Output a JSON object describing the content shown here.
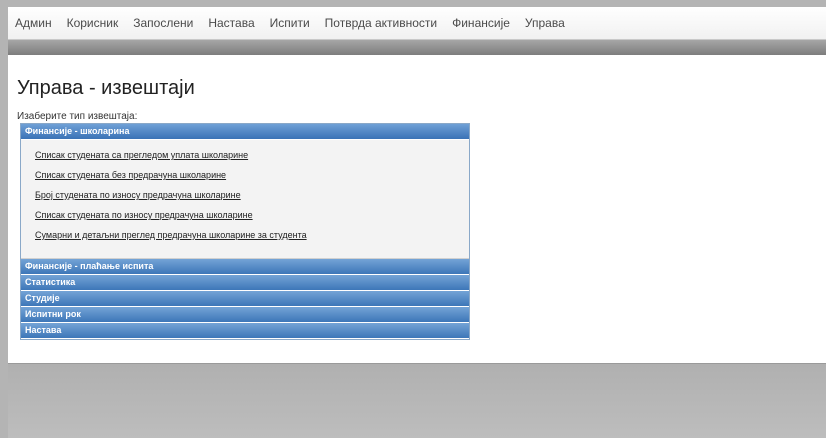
{
  "nav": {
    "items": [
      "Админ",
      "Корисник",
      "Запослени",
      "Настава",
      "Испити",
      "Потврда активности",
      "Финансије",
      "Управа"
    ]
  },
  "page": {
    "title": "Управа - извештаји",
    "choose_label": "Изаберите тип извештаја:"
  },
  "accordion": {
    "sections": [
      {
        "title": "Финансије - школарина",
        "expanded": true,
        "links": [
          "Списак студената са прегледом уплата школарине",
          "Списак студената без предрачуна школарине",
          "Број студената по износу предрачуна школарине",
          "Списак студената по износу предрачуна школарине",
          "Сумарни и детаљни преглед предрачуна школарине за студента"
        ]
      },
      {
        "title": "Финансије - плаћање испита",
        "expanded": false
      },
      {
        "title": "Статистика",
        "expanded": false
      },
      {
        "title": "Студије",
        "expanded": false
      },
      {
        "title": "Испитни рок",
        "expanded": false
      },
      {
        "title": "Настава",
        "expanded": false
      }
    ]
  }
}
